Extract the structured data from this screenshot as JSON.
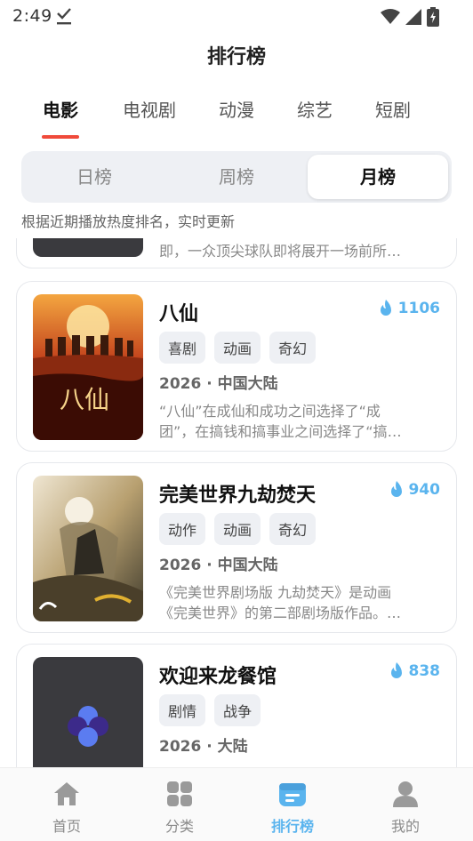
{
  "status_bar": {
    "time": "2:49"
  },
  "page_title": "排行榜",
  "category_tabs": [
    {
      "label": "电影"
    },
    {
      "label": "电视剧"
    },
    {
      "label": "动漫"
    },
    {
      "label": "综艺"
    },
    {
      "label": "短剧"
    }
  ],
  "active_category": "电影",
  "period_tabs": [
    {
      "label": "日榜"
    },
    {
      "label": "周榜"
    },
    {
      "label": "月榜"
    }
  ],
  "active_period": "月榜",
  "hint": "根据近期播放热度排名，实时更新",
  "partial_card": {
    "desc": "即，一众顶尖球队即将展开一场前所…"
  },
  "items": [
    {
      "title": "八仙",
      "hot": "1106",
      "tags": [
        "喜剧",
        "动画",
        "奇幻"
      ],
      "meta": "2026 · 中国大陆",
      "desc_line1": "“八仙”在成仙和成功之间选择了“成",
      "desc_line2": "团”，在搞钱和搞事业之间选择了“搞…",
      "poster_text": "八仙"
    },
    {
      "title": "完美世界九劫焚天",
      "hot": "940",
      "tags": [
        "动作",
        "动画",
        "奇幻"
      ],
      "meta": "2026 · 中国大陆",
      "desc_line1": "《完美世界剧场版 九劫焚天》是动画",
      "desc_line2": "《完美世界》的第二部剧场版作品。…"
    },
    {
      "title": "欢迎来龙餐馆",
      "hot": "838",
      "tags": [
        "剧情",
        "战争"
      ],
      "meta": "2026 · 大陆"
    }
  ],
  "bottom_nav": [
    {
      "label": "首页",
      "icon": "home-icon"
    },
    {
      "label": "分类",
      "icon": "grid-icon"
    },
    {
      "label": "排行榜",
      "icon": "ranking-icon"
    },
    {
      "label": "我的",
      "icon": "profile-icon"
    }
  ],
  "active_nav": "排行榜",
  "colors": {
    "accent_red": "#f04a3a",
    "accent_blue": "#5ab4ee"
  }
}
